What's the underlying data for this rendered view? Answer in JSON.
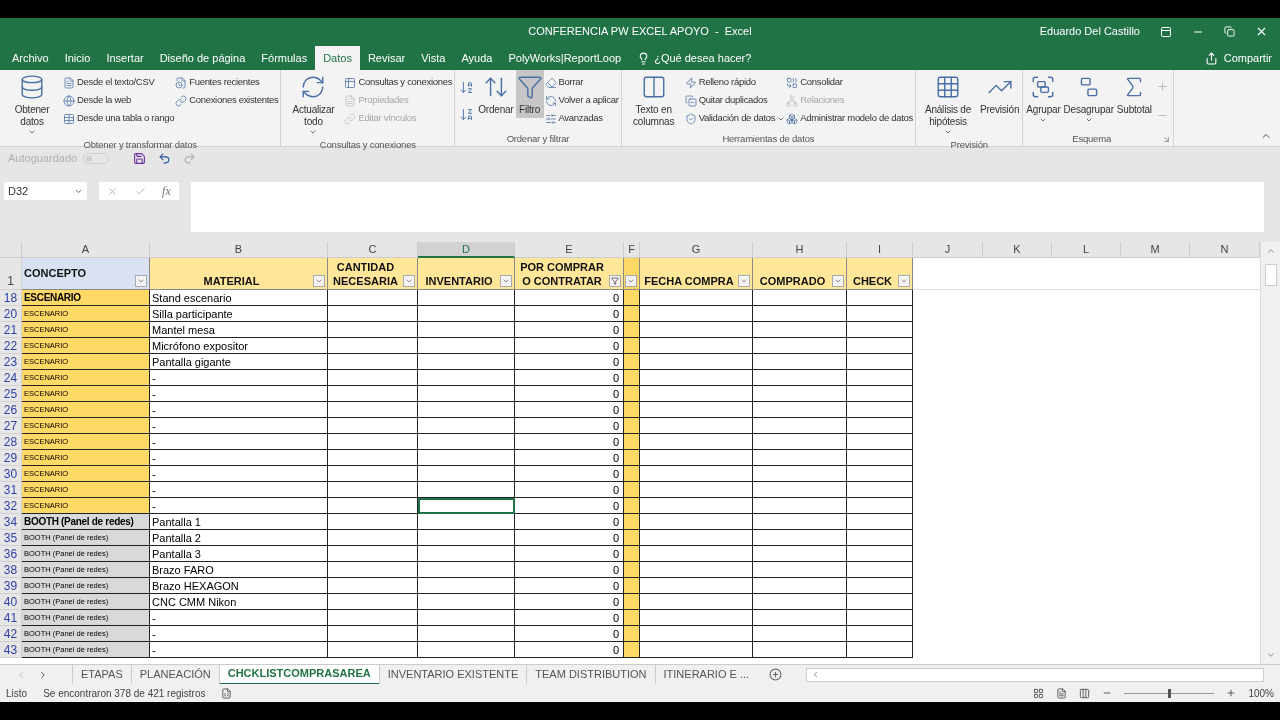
{
  "window": {
    "title": "CONFERENCIA PW EXCEL APOYO  -  Excel",
    "user": "Eduardo Del Castillo"
  },
  "menu_tabs": [
    {
      "label": "Archivo",
      "selected": false
    },
    {
      "label": "Inicio",
      "selected": false
    },
    {
      "label": "Insertar",
      "selected": false
    },
    {
      "label": "Diseño de página",
      "selected": false
    },
    {
      "label": "Fórmulas",
      "selected": false
    },
    {
      "label": "Datos",
      "selected": true
    },
    {
      "label": "Revisar",
      "selected": false
    },
    {
      "label": "Vista",
      "selected": false
    },
    {
      "label": "Ayuda",
      "selected": false
    },
    {
      "label": "PolyWorks|ReportLoop",
      "selected": false
    }
  ],
  "tell_me": {
    "placeholder": "¿Qué desea hacer?"
  },
  "share": "Compartir",
  "ribbon": {
    "groups": [
      {
        "label": "Obtener y transformar datos",
        "items": [
          {
            "kind": "large",
            "label": "Obtener datos",
            "dropdown": true,
            "pressed": false
          },
          {
            "kind": "stack",
            "items": [
              {
                "label": "Desde el texto/CSV",
                "disabled": false,
                "dropdown": false
              },
              {
                "label": "Desde la web",
                "disabled": false,
                "dropdown": false
              },
              {
                "label": "Desde una tabla o rango",
                "disabled": false,
                "dropdown": false
              }
            ]
          },
          {
            "kind": "stack",
            "items": [
              {
                "label": "Fuentes recientes",
                "disabled": false,
                "dropdown": false
              },
              {
                "label": "Conexiones existentes",
                "disabled": false,
                "dropdown": false
              }
            ]
          }
        ]
      },
      {
        "label": "Consultas y conexiones",
        "items": [
          {
            "kind": "large",
            "label": "Actualizar todo",
            "dropdown": true,
            "pressed": false
          },
          {
            "kind": "stack",
            "items": [
              {
                "label": "Consultas y conexiones",
                "disabled": false,
                "dropdown": false
              },
              {
                "label": "Propiedades",
                "disabled": true,
                "dropdown": false
              },
              {
                "label": "Editar vínculos",
                "disabled": true,
                "dropdown": false
              }
            ]
          }
        ]
      },
      {
        "label": "Ordenar y filtrar",
        "items": [
          {
            "kind": "sort"
          },
          {
            "kind": "large",
            "label": "Ordenar",
            "dropdown": false,
            "pressed": false
          },
          {
            "kind": "large",
            "label": "Filtro",
            "dropdown": false,
            "pressed": true
          },
          {
            "kind": "stack",
            "items": [
              {
                "label": "Borrar",
                "disabled": false,
                "dropdown": false
              },
              {
                "label": "Volver a aplicar",
                "disabled": false,
                "dropdown": false
              },
              {
                "label": "Avanzadas",
                "disabled": false,
                "dropdown": false
              }
            ]
          }
        ]
      },
      {
        "label": "Herramientas de datos",
        "items": [
          {
            "kind": "large",
            "label": "Texto en columnas",
            "dropdown": false,
            "pressed": false
          },
          {
            "kind": "stack",
            "items": [
              {
                "label": "Relleno rápido",
                "disabled": false,
                "dropdown": false
              },
              {
                "label": "Quitar duplicados",
                "disabled": false,
                "dropdown": false
              },
              {
                "label": "Validación de datos",
                "disabled": false,
                "dropdown": true
              }
            ]
          },
          {
            "kind": "stack",
            "items": [
              {
                "label": "Consolidar",
                "disabled": false,
                "dropdown": false
              },
              {
                "label": "Relaciones",
                "disabled": true,
                "dropdown": false
              },
              {
                "label": "Administrar modelo de datos",
                "disabled": false,
                "dropdown": false
              }
            ]
          }
        ]
      },
      {
        "label": "Previsión",
        "items": [
          {
            "kind": "large",
            "label": "Análisis de hipótesis",
            "dropdown": true,
            "pressed": false
          },
          {
            "kind": "large",
            "label": "Previsión",
            "dropdown": false,
            "pressed": false
          }
        ]
      },
      {
        "label": "Esquema",
        "items": [
          {
            "kind": "large",
            "label": "Agrupar",
            "dropdown": true,
            "pressed": false
          },
          {
            "kind": "large",
            "label": "Desagrupar",
            "dropdown": true,
            "pressed": false
          },
          {
            "kind": "large",
            "label": "Subtotal",
            "dropdown": false,
            "pressed": false
          },
          {
            "kind": "outline"
          }
        ]
      }
    ]
  },
  "quick_access": {
    "autosave": {
      "label": "Autoguardado",
      "on": false
    }
  },
  "formula_bar": {
    "name_box": "D32",
    "function_label": "fx"
  },
  "columns": [
    {
      "letter": "A",
      "selected": false
    },
    {
      "letter": "B",
      "selected": false
    },
    {
      "letter": "C",
      "selected": false
    },
    {
      "letter": "D",
      "selected": true
    },
    {
      "letter": "E",
      "selected": false
    },
    {
      "letter": "F",
      "selected": false
    },
    {
      "letter": "G",
      "selected": false
    },
    {
      "letter": "H",
      "selected": false
    },
    {
      "letter": "I",
      "selected": false
    },
    {
      "letter": "J",
      "selected": false
    },
    {
      "letter": "K",
      "selected": false
    },
    {
      "letter": "L",
      "selected": false
    },
    {
      "letter": "M",
      "selected": false
    },
    {
      "letter": "N",
      "selected": false
    }
  ],
  "header_row": {
    "num": "1",
    "cells": [
      {
        "label": "CONCEPTO",
        "filtered": false,
        "color": "#d9e1f2"
      },
      {
        "label": "MATERIAL",
        "filtered": false,
        "color": "#ffe699"
      },
      {
        "label": "CANTIDAD NECESARIA",
        "filtered": false,
        "color": "#ffe699"
      },
      {
        "label": "INVENTARIO",
        "filtered": false,
        "color": "#ffe699"
      },
      {
        "label": "POR COMPRAR O CONTRATAR",
        "filtered": true,
        "color": "#ffe699"
      },
      {
        "filtered": false,
        "color": "#ffd966"
      },
      {
        "label": "FECHA COMPRA",
        "filtered": false,
        "color": "#ffe699"
      },
      {
        "label": "COMPRADO",
        "filtered": false,
        "color": "#ffe699"
      },
      {
        "label": "CHECK",
        "filtered": false,
        "color": "#ffe699"
      }
    ]
  },
  "rows": [
    {
      "num": "18",
      "concept": "ESCENARIO",
      "material": "Stand escenario",
      "to_buy": "0",
      "heading": true,
      "selected": false,
      "color": "#ffd966"
    },
    {
      "num": "20",
      "concept": "ESCENARIO",
      "material": "Silla participante",
      "to_buy": "0",
      "heading": false,
      "selected": false,
      "color": "#ffd966"
    },
    {
      "num": "21",
      "concept": "ESCENARIO",
      "material": "Mantel mesa",
      "to_buy": "0",
      "heading": false,
      "selected": false,
      "color": "#ffd966"
    },
    {
      "num": "22",
      "concept": "ESCENARIO",
      "material": "Micrófono expositor",
      "to_buy": "0",
      "heading": false,
      "selected": false,
      "color": "#ffd966"
    },
    {
      "num": "23",
      "concept": "ESCENARIO",
      "material": "Pantalla gigante",
      "to_buy": "0",
      "heading": false,
      "selected": false,
      "color": "#ffd966"
    },
    {
      "num": "24",
      "concept": "ESCENARIO",
      "material": "-",
      "to_buy": "0",
      "heading": false,
      "selected": false,
      "color": "#ffd966"
    },
    {
      "num": "25",
      "concept": "ESCENARIO",
      "material": "-",
      "to_buy": "0",
      "heading": false,
      "selected": false,
      "color": "#ffd966"
    },
    {
      "num": "26",
      "concept": "ESCENARIO",
      "material": "-",
      "to_buy": "0",
      "heading": false,
      "selected": false,
      "color": "#ffd966"
    },
    {
      "num": "27",
      "concept": "ESCENARIO",
      "material": "-",
      "to_buy": "0",
      "heading": false,
      "selected": false,
      "color": "#ffd966"
    },
    {
      "num": "28",
      "concept": "ESCENARIO",
      "material": "-",
      "to_buy": "0",
      "heading": false,
      "selected": false,
      "color": "#ffd966"
    },
    {
      "num": "29",
      "concept": "ESCENARIO",
      "material": "-",
      "to_buy": "0",
      "heading": false,
      "selected": false,
      "color": "#ffd966"
    },
    {
      "num": "30",
      "concept": "ESCENARIO",
      "material": "-",
      "to_buy": "0",
      "heading": false,
      "selected": false,
      "color": "#ffd966"
    },
    {
      "num": "31",
      "concept": "ESCENARIO",
      "material": "-",
      "to_buy": "0",
      "heading": false,
      "selected": false,
      "color": "#ffd966"
    },
    {
      "num": "32",
      "concept": "ESCENARIO",
      "material": "-",
      "to_buy": "0",
      "heading": false,
      "selected": true,
      "color": "#ffd966"
    },
    {
      "num": "34",
      "concept": "BOOTH (Panel de redes)",
      "material": "Pantalla 1",
      "to_buy": "0",
      "heading": true,
      "selected": false,
      "color": "#d9d9d9"
    },
    {
      "num": "35",
      "concept": "BOOTH (Panel de redes)",
      "material": "Pantalla 2",
      "to_buy": "0",
      "heading": false,
      "selected": false,
      "color": "#d9d9d9"
    },
    {
      "num": "36",
      "concept": "BOOTH (Panel de redes)",
      "material": "Pantalla 3",
      "to_buy": "0",
      "heading": false,
      "selected": false,
      "color": "#d9d9d9"
    },
    {
      "num": "38",
      "concept": "BOOTH (Panel de redes)",
      "material": "Brazo FARO",
      "to_buy": "0",
      "heading": false,
      "selected": false,
      "color": "#d9d9d9"
    },
    {
      "num": "39",
      "concept": "BOOTH (Panel de redes)",
      "material": "Brazo HEXAGON",
      "to_buy": "0",
      "heading": false,
      "selected": false,
      "color": "#d9d9d9"
    },
    {
      "num": "40",
      "concept": "BOOTH (Panel de redes)",
      "material": "CNC CMM Nikon",
      "to_buy": "0",
      "heading": false,
      "selected": false,
      "color": "#d9d9d9"
    },
    {
      "num": "41",
      "concept": "BOOTH (Panel de redes)",
      "material": "-",
      "to_buy": "0",
      "heading": false,
      "selected": false,
      "color": "#d9d9d9"
    },
    {
      "num": "42",
      "concept": "BOOTH (Panel de redes)",
      "material": "-",
      "to_buy": "0",
      "heading": false,
      "selected": false,
      "color": "#d9d9d9"
    },
    {
      "num": "43",
      "concept": "BOOTH (Panel de redes)",
      "material": "-",
      "to_buy": "0",
      "heading": false,
      "selected": false,
      "color": "#d9d9d9"
    }
  ],
  "sheet_tabs": [
    {
      "label": "ETAPAS",
      "selected": false
    },
    {
      "label": "PLANEACIÓN",
      "selected": false
    },
    {
      "label": "CHCKLISTCOMPRASAREA",
      "selected": true
    },
    {
      "label": "INVENTARIO EXISTENTE",
      "selected": false
    },
    {
      "label": "TEAM DISTRIBUTION",
      "selected": false
    },
    {
      "label": "ITINERARIO E ...",
      "selected": false
    }
  ],
  "status_bar": {
    "state": "Listo",
    "message": "Se encontraron 378 de 421 registros",
    "zoom": {
      "label": "100%",
      "level": 0.5
    }
  }
}
